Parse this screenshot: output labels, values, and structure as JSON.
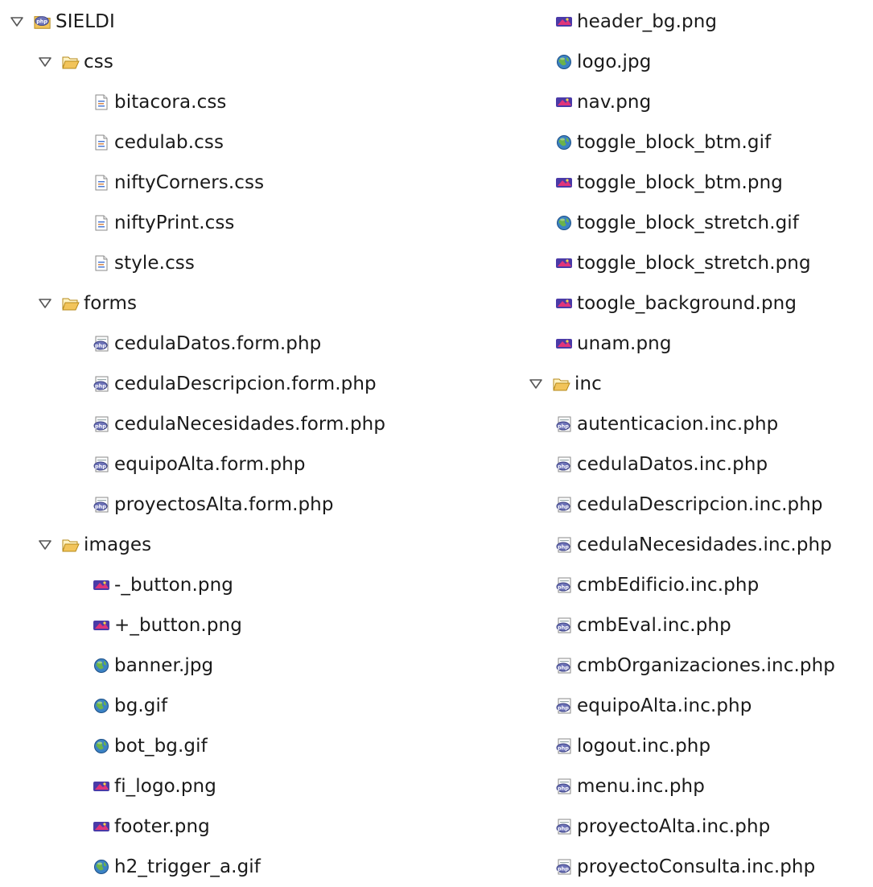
{
  "tree": {
    "left": [
      {
        "label": "SIELDI",
        "icon": "php-project-icon",
        "level": 0,
        "expanded": true
      },
      {
        "label": "css",
        "icon": "folder-open-icon",
        "level": 1,
        "expanded": true
      },
      {
        "label": "bitacora.css",
        "icon": "css-file-icon",
        "level": 2
      },
      {
        "label": "cedulab.css",
        "icon": "css-file-icon",
        "level": 2
      },
      {
        "label": "niftyCorners.css",
        "icon": "css-file-icon",
        "level": 2
      },
      {
        "label": "niftyPrint.css",
        "icon": "css-file-icon",
        "level": 2
      },
      {
        "label": "style.css",
        "icon": "css-file-icon",
        "level": 2
      },
      {
        "label": "forms",
        "icon": "folder-open-icon",
        "level": 1,
        "expanded": true
      },
      {
        "label": "cedulaDatos.form.php",
        "icon": "php-file-icon",
        "level": 2
      },
      {
        "label": "cedulaDescripcion.form.php",
        "icon": "php-file-icon",
        "level": 2
      },
      {
        "label": "cedulaNecesidades.form.php",
        "icon": "php-file-icon",
        "level": 2
      },
      {
        "label": "equipoAlta.form.php",
        "icon": "php-file-icon",
        "level": 2
      },
      {
        "label": "proyectosAlta.form.php",
        "icon": "php-file-icon",
        "level": 2
      },
      {
        "label": "images",
        "icon": "folder-open-icon",
        "level": 1,
        "expanded": true
      },
      {
        "label": "-_button.png",
        "icon": "png-image-icon",
        "level": 2
      },
      {
        "label": "+_button.png",
        "icon": "png-image-icon",
        "level": 2
      },
      {
        "label": "banner.jpg",
        "icon": "web-image-icon",
        "level": 2
      },
      {
        "label": "bg.gif",
        "icon": "web-image-icon",
        "level": 2
      },
      {
        "label": "bot_bg.gif",
        "icon": "web-image-icon",
        "level": 2
      },
      {
        "label": "fi_logo.png",
        "icon": "png-image-icon",
        "level": 2
      },
      {
        "label": "footer.png",
        "icon": "png-image-icon",
        "level": 2
      },
      {
        "label": "h2_trigger_a.gif",
        "icon": "web-image-icon",
        "level": 2
      }
    ],
    "right": [
      {
        "label": "header_bg.png",
        "icon": "png-image-icon",
        "level": 2
      },
      {
        "label": "logo.jpg",
        "icon": "web-image-icon",
        "level": 2
      },
      {
        "label": "nav.png",
        "icon": "png-image-icon",
        "level": 2
      },
      {
        "label": "toggle_block_btm.gif",
        "icon": "web-image-icon",
        "level": 2
      },
      {
        "label": "toggle_block_btm.png",
        "icon": "png-image-icon",
        "level": 2
      },
      {
        "label": "toggle_block_stretch.gif",
        "icon": "web-image-icon",
        "level": 2
      },
      {
        "label": "toggle_block_stretch.png",
        "icon": "png-image-icon",
        "level": 2
      },
      {
        "label": "toogle_background.png",
        "icon": "png-image-icon",
        "level": 2
      },
      {
        "label": "unam.png",
        "icon": "png-image-icon",
        "level": 2
      },
      {
        "label": "inc",
        "icon": "folder-open-icon",
        "level": 1,
        "expanded": true
      },
      {
        "label": "autenticacion.inc.php",
        "icon": "php-file-icon",
        "level": 2
      },
      {
        "label": "cedulaDatos.inc.php",
        "icon": "php-file-icon",
        "level": 2
      },
      {
        "label": "cedulaDescripcion.inc.php",
        "icon": "php-file-icon",
        "level": 2
      },
      {
        "label": "cedulaNecesidades.inc.php",
        "icon": "php-file-icon",
        "level": 2
      },
      {
        "label": "cmbEdificio.inc.php",
        "icon": "php-file-icon",
        "level": 2
      },
      {
        "label": "cmbEval.inc.php",
        "icon": "php-file-icon",
        "level": 2
      },
      {
        "label": "cmbOrganizaciones.inc.php",
        "icon": "php-file-icon",
        "level": 2
      },
      {
        "label": "equipoAlta.inc.php",
        "icon": "php-file-icon",
        "level": 2
      },
      {
        "label": "logout.inc.php",
        "icon": "php-file-icon",
        "level": 2
      },
      {
        "label": "menu.inc.php",
        "icon": "php-file-icon",
        "level": 2
      },
      {
        "label": "proyectoAlta.inc.php",
        "icon": "php-file-icon",
        "level": 2
      },
      {
        "label": "proyectoConsulta.inc.php",
        "icon": "php-file-icon",
        "level": 2
      }
    ]
  },
  "colors": {
    "folder": "#f2c45a",
    "php_badge": "#6d73b8",
    "png_icon": "#4a3aa8",
    "globe": "#3b82c4",
    "twisty": "#555555"
  }
}
